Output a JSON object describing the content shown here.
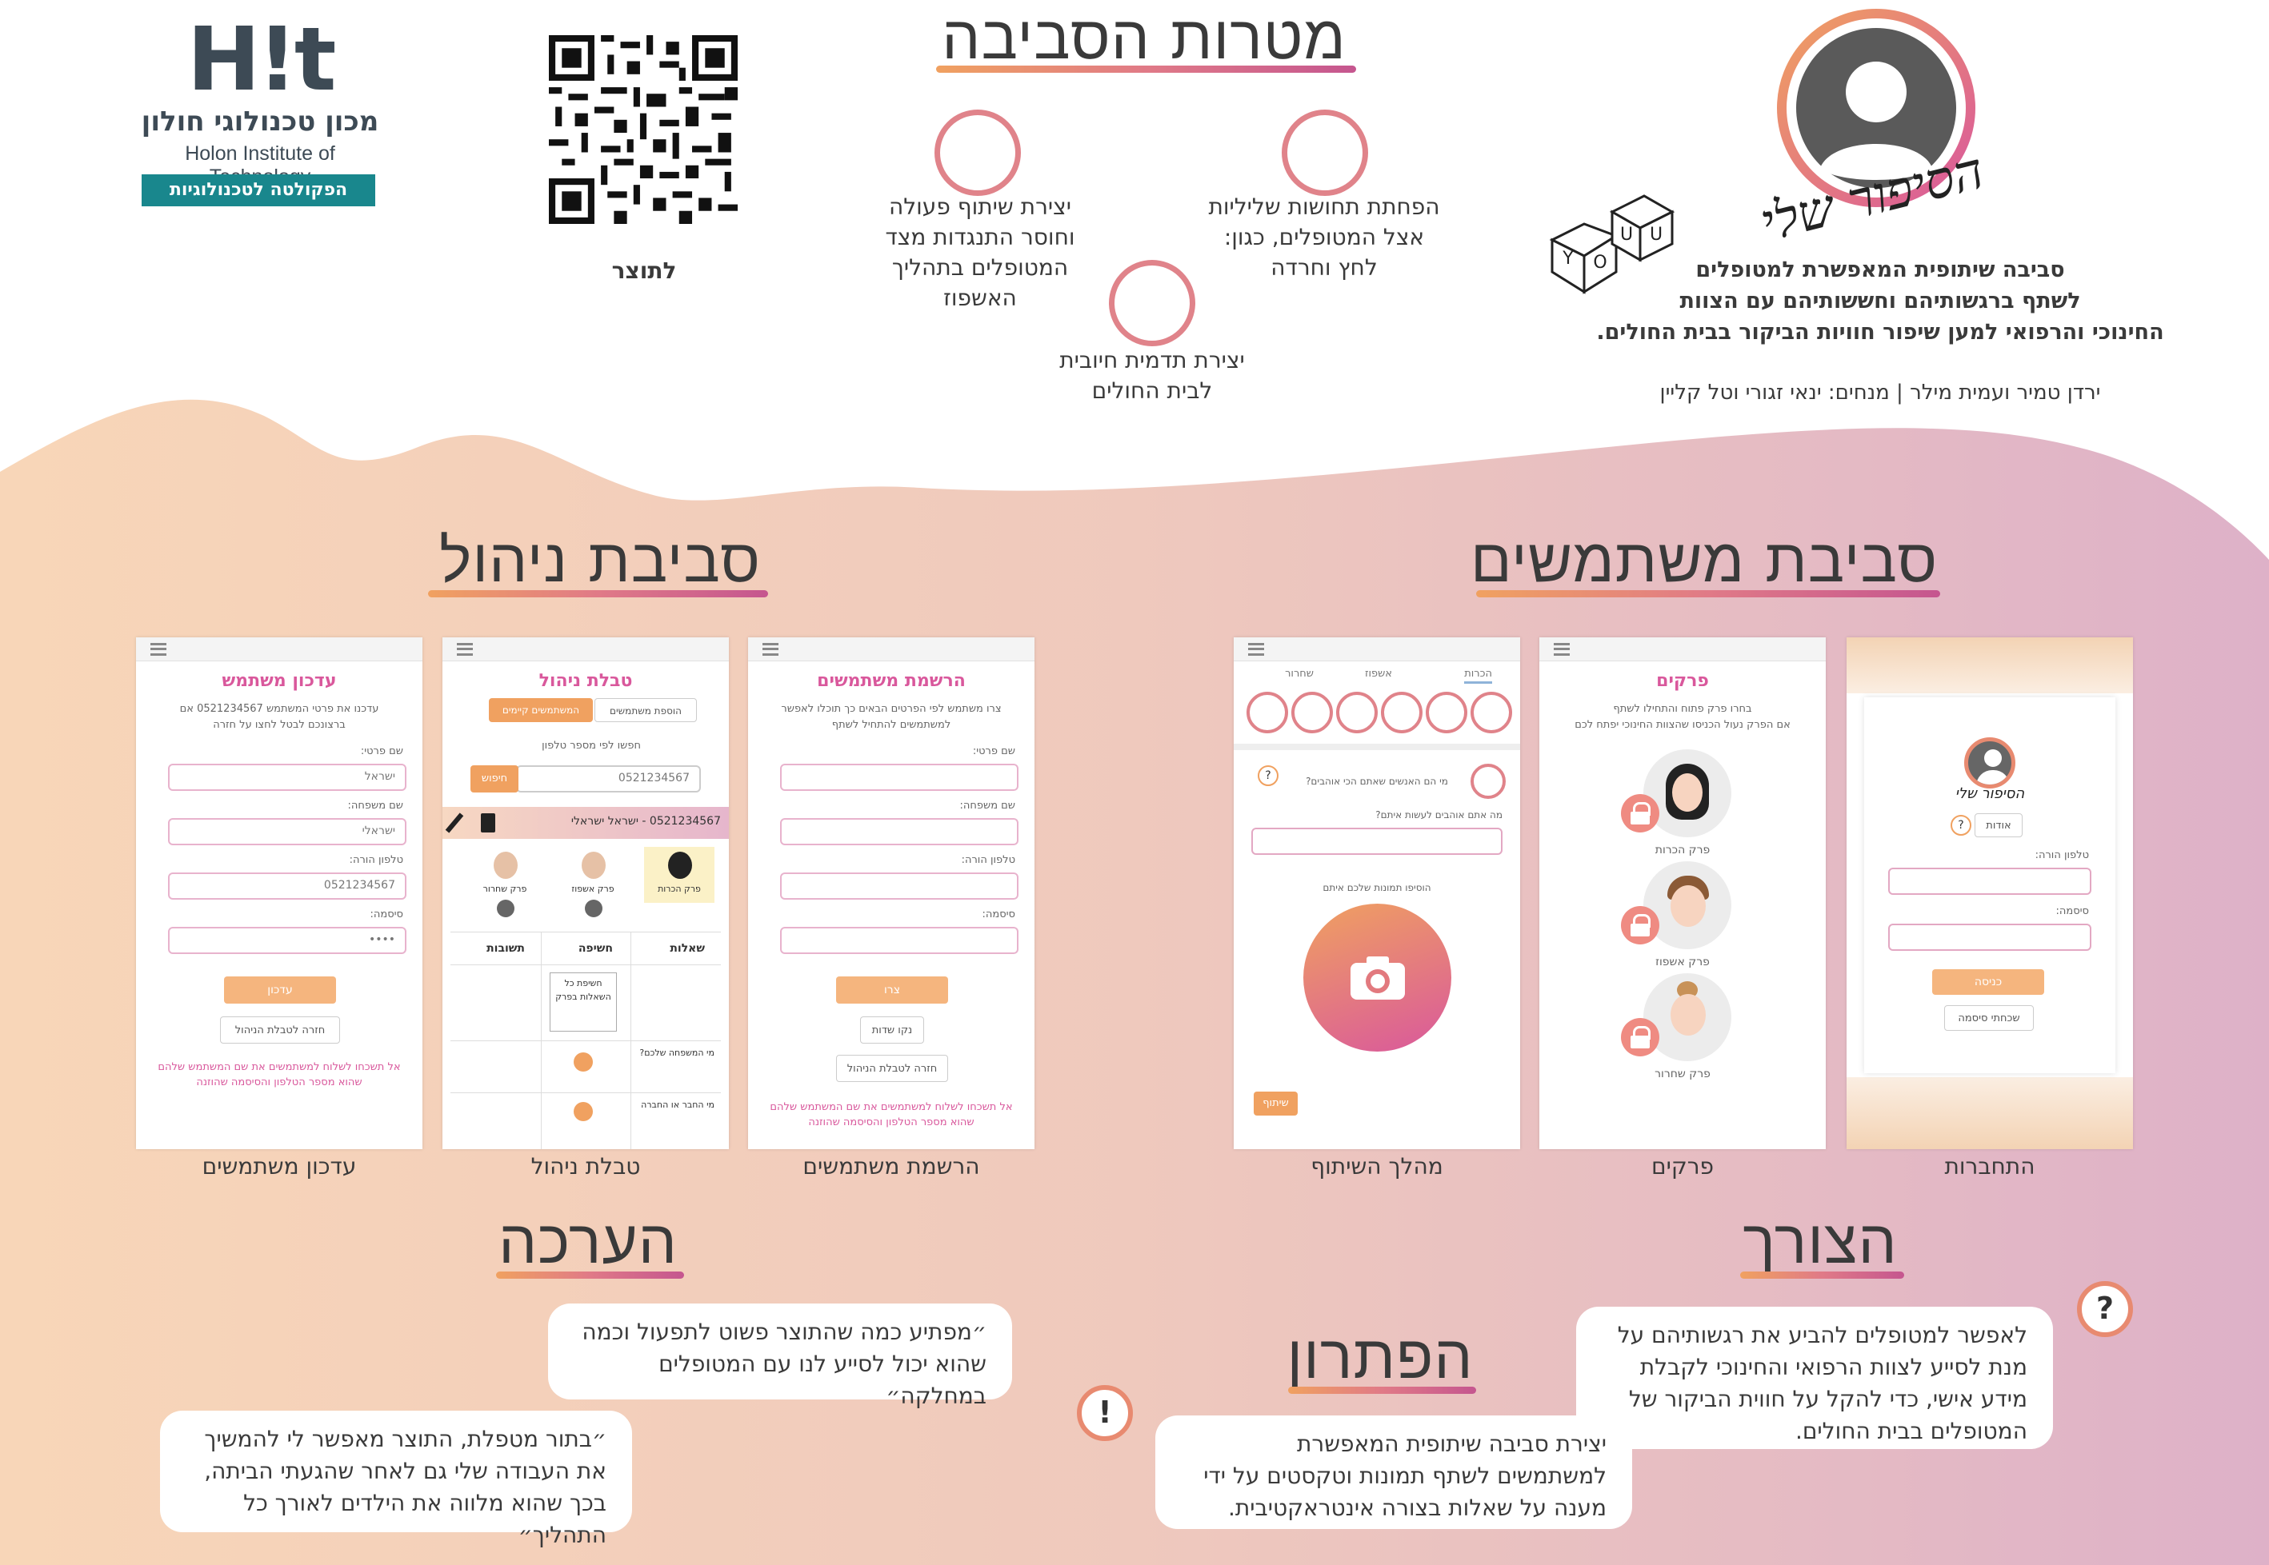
{
  "header": {
    "product_name": "הסיפור שלי",
    "tagline_lines": [
      "סביבה שיתופית המאפשרת למטופלים",
      "לשתף ברגשותיהם וחששותיהם עם הצוות",
      "החינוכי והרפואי למען שיפור חוויות הביקור בבית החולים."
    ],
    "credits": "ירדן טמיר ועמית מילר | מנחים: ינאי זגורי וטל קליין",
    "qr_caption": "לתוצר",
    "institute": {
      "logo_text": "H!t",
      "name_he": "מכון טכנולוגי חולון",
      "name_en": "Holon Institute of Technology",
      "faculty": "הפקולטה לטכנולוגיות למידה"
    }
  },
  "goals": {
    "title": "מטרות הסביבה",
    "items": [
      "הפחתת תחושות שליליות אצל המטופלים, כגון: לחץ וחרדה",
      "יצירת שיתוף פעולה וחוסר התנגדות מצד המטופלים בתהליך האשפוז",
      "יצירת תדמית חיובית לבית החולים"
    ]
  },
  "user_env": {
    "title": "סביבת משתמשים",
    "screens": [
      "התחברות",
      "פרקים",
      "מהלך השיתוף"
    ]
  },
  "admin_env": {
    "title": "סביבת ניהול",
    "screens": [
      "הרשמת משתמשים",
      "טבלת ניהול",
      "עדכון משתמשים"
    ]
  },
  "need": {
    "title": "הצורך",
    "text": "לאפשר למטופלים להביע את רגשותיהם על מנת לסייע לצוות הרפואי והחינוכי לקבלת מידע אישי, כדי להקל על חווית הביקור של המטופלים בבית החולים.",
    "icon": "?"
  },
  "solution": {
    "title": "הפתרון",
    "text": "יצירת סביבה שיתופית המאפשרת למשתמשים לשתף תמונות וטקסטים על ידי מענה על שאלות בצורה אינטראקטיבית.",
    "icon": "!"
  },
  "evaluation": {
    "title": "הערכה",
    "quotes": [
      "״מפתיע כמה שהתוצר פשוט לתפעול וכמה שהוא יכול לסייע לנו עם המטופלים במחלקה״",
      "״בתור מטפלת, התוצר מאפשר לי להמשיך את העבודה שלי גם לאחר שהגעתי הביתה, בכך שהוא מלווה את הילדים לאורך כל התהליך״"
    ]
  },
  "mock_login": {
    "logo": "הסיפור שלי",
    "about_btn": "אודות",
    "help": "?",
    "phone_label": "טלפון הורה:",
    "password_label": "סיסמה:",
    "login_btn": "כניסה",
    "forgot_btn": "שכחתי סיסמה"
  },
  "mock_chapters": {
    "title": "פרקים",
    "subtitle": "בחרו פרק פתוח והתחילו לשתף",
    "subtitle2": "אם הפרק נעול הכניסו שהצוות החינוכי יפתח לכם",
    "items": [
      "פרק הכרות",
      "פרק אשפוז",
      "פרק שחרור"
    ]
  },
  "mock_share": {
    "tabs": [
      "הכרות",
      "אשפוז",
      "שחרור"
    ],
    "question": "מי הם האנשים שאתם הכי אוהבים?",
    "help": "?",
    "q2": "מה אתם אוהבים לעשות איתם?",
    "upload_label": "הוסיפו תמונות שלכם איתם",
    "share_btn": "שיתוף"
  },
  "mock_register": {
    "title": "הרשמת משתמשים",
    "subtitle": "צרו משתמש לפי הפרטים הבאים כך תוכלו לאפשר למשתמשים להתחיל לשתף",
    "labels": [
      "שם פרטי:",
      "שם משפחה:",
      "טלפון הורה:",
      "סיסמה:"
    ],
    "create_btn": "צרו",
    "clear_btn": "נקו שדות",
    "back_btn": "חזרה לטבלת הניהול",
    "warn": "אל תשכחו לשלוח למשתמשים את שם המשתמש שלהם שהוא מספר הטלפון והסיסמה שהוזנה"
  },
  "mock_table": {
    "title": "טבלת ניהול",
    "tab_active": "המשתמשים קיימים",
    "tab_other": "הוספת משתמשים",
    "search_label": "חפשו לפי מספר טלפון",
    "search_value": "0521234567",
    "search_btn": "חיפוש",
    "user_row": "0521234567 - ישראל ישראלי",
    "chapters": [
      "פרק הכרות",
      "פרק אשפוז",
      "פרק שחרור"
    ],
    "cols": [
      "שאלות",
      "חשיפה",
      "תשובות"
    ],
    "rows": [
      {
        "q": "",
        "reveal": "חשיפת כל השאלות בפרק",
        "a": ""
      },
      {
        "q": "מי המשפחה שלכם?",
        "reveal": "",
        "a": ""
      },
      {
        "q": "מי החבר או החברה",
        "reveal": "",
        "a": ""
      }
    ]
  },
  "mock_update": {
    "title": "עדכון משתמש",
    "subtitle": "עדכנו את פרטי המשתמש 0521234567 אם ברצונכם לבטל לחצו על חזרה",
    "labels": [
      "שם פרטי:",
      "שם משפחה:",
      "טלפון הורה:",
      "סיסמה:"
    ],
    "values": [
      "ישראל",
      "ישראלי",
      "0521234567",
      "••••"
    ],
    "update_btn": "עדכון",
    "back_btn": "חזרה לטבלת הניהול",
    "warn": "אל תשכחו לשלוח למשתמשים את שם המשתמש שלהם שהוא מספר הטלפון והסיסמה שהוזנה"
  },
  "colors": {
    "accent_pink": "#d9589c",
    "accent_orange": "#f0a160",
    "bg_peach": "#f7d2b3",
    "bg_mauve": "#dfb4c7"
  }
}
